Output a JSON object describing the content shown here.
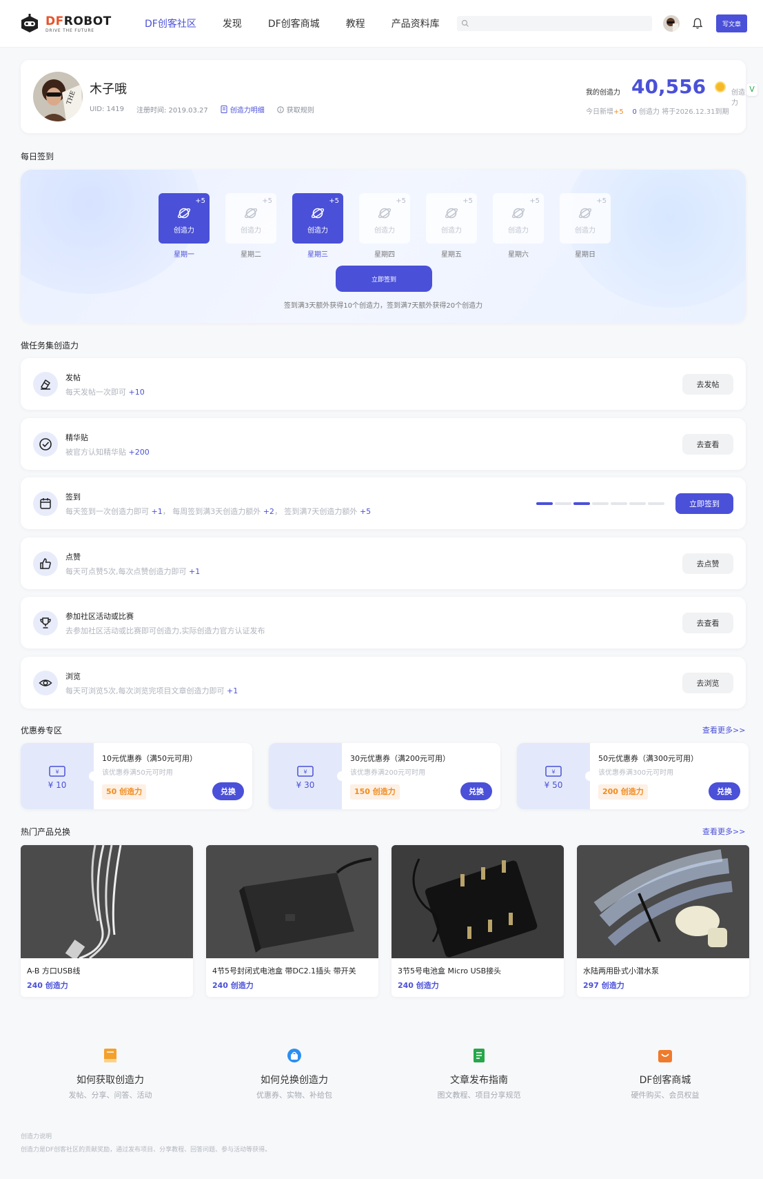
{
  "header": {
    "logo_title_df": "DF",
    "logo_title_robot": "ROBOT",
    "logo_tagline": "DRIVE THE FUTURE",
    "nav": [
      "DF创客社区",
      "发现",
      "DF创客商城",
      "教程",
      "产品资料库"
    ],
    "nav_active_index": 0,
    "search_placeholder": "",
    "write_label": "写文章"
  },
  "profile": {
    "name": "木子哦",
    "uid": "UID: 1419",
    "registered": "注册时间: 2019.03.27",
    "detail_link": "创造力明细",
    "rules_link": "获取规则",
    "points_label": "我的创造力",
    "points_value": "40,556",
    "points_unit": "创造力",
    "today_label": "今日新增",
    "today_value": "+5",
    "expire_value": "0",
    "expire_text": "创造力 将于2026.12.31到期",
    "side_tab": "V"
  },
  "checkin": {
    "section_title": "每日签到",
    "days": [
      {
        "name": "星期一",
        "plus": "+5",
        "label": "创造力",
        "done": true
      },
      {
        "name": "星期二",
        "plus": "+5",
        "label": "创造力",
        "done": false
      },
      {
        "name": "星期三",
        "plus": "+5",
        "label": "创造力",
        "done": true
      },
      {
        "name": "星期四",
        "plus": "+5",
        "label": "创造力",
        "done": false
      },
      {
        "name": "星期五",
        "plus": "+5",
        "label": "创造力",
        "done": false
      },
      {
        "name": "星期六",
        "plus": "+5",
        "label": "创造力",
        "done": false
      },
      {
        "name": "星期日",
        "plus": "+5",
        "label": "创造力",
        "done": false
      }
    ],
    "button": "立即签到",
    "tip": "签到满3天额外获得10个创造力，签到满7天额外获得20个创造力"
  },
  "tasks": {
    "section_title": "做任务集创造力",
    "items": [
      {
        "icon": "eraser-icon",
        "name": "发帖",
        "desc": "每天发帖一次即可",
        "bonus": "+10",
        "button": "去发帖"
      },
      {
        "icon": "check-circle-icon",
        "name": "精华贴",
        "desc": "被官方认知精华贴",
        "bonus": "+200",
        "button": "去查看"
      },
      {
        "icon": "calendar-icon",
        "name": "签到",
        "desc": "每天签到一次创造力即可",
        "bonus": "+1",
        "desc2": "，  每周签到满3天创造力额外",
        "bonus2": "+2",
        "desc3": "，  签到满7天创造力额外",
        "bonus3": "+5",
        "button": "立即签到",
        "progress_done": [
          true,
          false,
          true,
          false,
          false,
          false,
          false
        ]
      },
      {
        "icon": "thumbs-up-icon",
        "name": "点赞",
        "desc": "每天可点赞5次,每次点赞创造力即可",
        "bonus": "+1",
        "button": "去点赞"
      },
      {
        "icon": "trophy-icon",
        "name": "参加社区活动或比赛",
        "desc": "去参加社区活动或比赛即可创造力,实际创造力官方认证发布",
        "bonus": "",
        "button": "去查看"
      },
      {
        "icon": "eye-icon",
        "name": "浏览",
        "desc": "每天可浏览5次,每次浏览完项目文章创造力即可",
        "bonus": "+1",
        "button": "去浏览"
      }
    ]
  },
  "coupons": {
    "section_title": "优惠券专区",
    "more": "查看更多>>",
    "items": [
      {
        "amount": "¥ 10",
        "title": "10元优惠券（满50元可用）",
        "sub": "该优惠券满50元可时用",
        "points": "50 创造力",
        "button": "兑换"
      },
      {
        "amount": "¥ 30",
        "title": "30元优惠券（满200元可用）",
        "sub": "该优惠券满200元可时用",
        "points": "150 创造力",
        "button": "兑换"
      },
      {
        "amount": "¥ 50",
        "title": "50元优惠券（满300元可用）",
        "sub": "该优惠券满300元可时用",
        "points": "200 创造力",
        "button": "兑换"
      }
    ]
  },
  "products": {
    "section_title": "热门产品兑换",
    "more": "查看更多>>",
    "items": [
      {
        "name": "A-B 方口USB线",
        "points": "240 创造力"
      },
      {
        "name": "4节5号封闭式电池盒 带DC2.1插头 带开关",
        "points": "240 创造力"
      },
      {
        "name": "3节5号电池盒 Micro USB接头",
        "points": "240 创造力"
      },
      {
        "name": "水陆两用卧式小潜水泵",
        "points": "297 创造力"
      }
    ]
  },
  "guides": [
    {
      "icon": "book-icon",
      "color": "#f5a02a",
      "title": "如何获取创造力",
      "sub": "发帖、分享、问答、活动"
    },
    {
      "icon": "gift-bag-icon",
      "color": "#2b8ff0",
      "title": "如何兑换创造力",
      "sub": "优惠券、实物、补给包"
    },
    {
      "icon": "document-icon",
      "color": "#27a64a",
      "title": "文章发布指南",
      "sub": "图文教程、项目分享规范"
    },
    {
      "icon": "shop-icon",
      "color": "#f07a2b",
      "title": "DF创客商城",
      "sub": "硬件购买、会员权益"
    }
  ],
  "footer": {
    "title": "创造力说明",
    "text": "创造力是DF创客社区的贡献奖励，通过发布项目、分享教程、回答问题、参与活动等获得。"
  },
  "colors": {
    "accent": "#4a50d8",
    "orange": "#f08c1f"
  }
}
